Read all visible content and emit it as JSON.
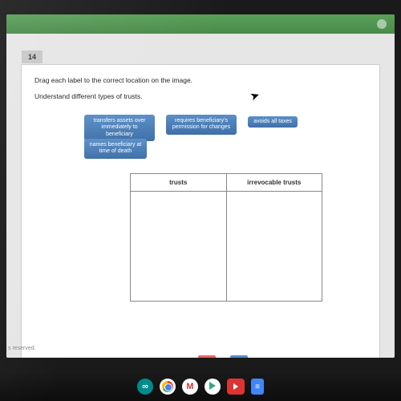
{
  "question": {
    "number": "14",
    "instruction_line1": "Drag each label to the correct location on the image.",
    "instruction_line2": "Understand different types of trusts."
  },
  "labels": {
    "item1": "transfers assets over immediately to beneficiary",
    "item2": "requires beneficiary's permission for changes",
    "item3": "avoids all taxes",
    "item4": "names beneficiary at time of death"
  },
  "table": {
    "col1": "trusts",
    "col2": "irrevocable trusts"
  },
  "footer": {
    "reserved": "s reserved."
  },
  "shelf": {
    "icon1": "∞"
  }
}
